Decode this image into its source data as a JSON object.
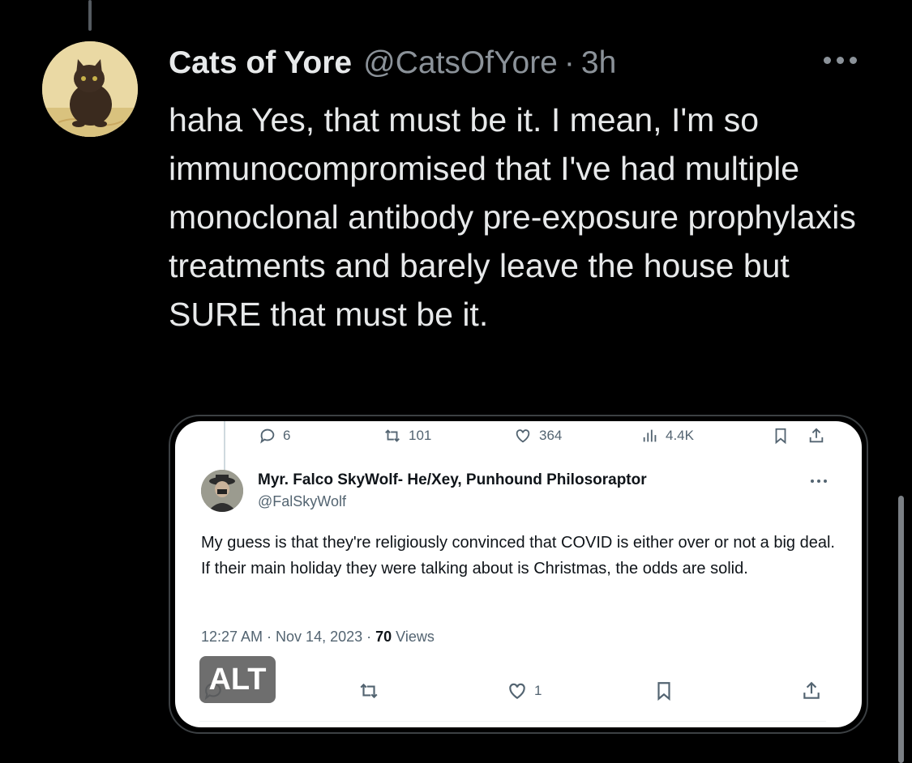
{
  "tweet": {
    "display_name": "Cats of Yore",
    "handle": "@CatsOfYore",
    "separator": "·",
    "time": "3h",
    "text": "haha Yes, that must be it. I mean, I'm so immunocompromised that I've had multiple monoclonal antibody pre-exposure prophylaxis treatments and barely leave the house but SURE that must be it.",
    "avatar_icon": "cat-portrait-avatar",
    "more_icon": "more-horizontal-icon"
  },
  "embedded_screenshot": {
    "metrics": {
      "replies": "6",
      "reposts": "101",
      "likes": "364",
      "views": "4.4K"
    },
    "post": {
      "name": "Myr. Falco SkyWolf- He/Xey, Punhound Philosoraptor",
      "handle": "@FalSkyWolf",
      "text": "My guess is that they're religiously convinced that COVID is either over or not a big deal. If their main holiday they were talking about is Christmas, the odds are solid.",
      "timestamp": "12:27 AM · Nov 14, 2023 · ",
      "view_count": "70",
      "views_label": " Views",
      "likes": "1"
    },
    "alt_badge": "ALT"
  },
  "colors": {
    "background": "#000000",
    "text": "#e7e9ea",
    "muted": "#8b9299"
  }
}
